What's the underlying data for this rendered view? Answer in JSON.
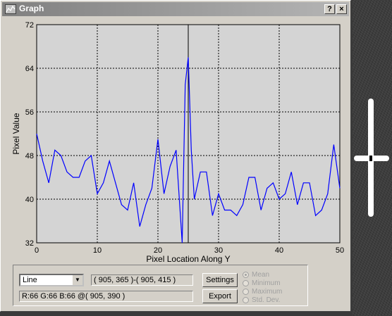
{
  "window": {
    "title": "Graph",
    "help_label": "?",
    "close_label": "×"
  },
  "chart_data": {
    "type": "line",
    "xlabel": "Pixel Location Along Y",
    "ylabel": "Pixel Value",
    "xlim": [
      0,
      50
    ],
    "ylim": [
      32,
      72
    ],
    "xticks": [
      0,
      10,
      20,
      30,
      40,
      50
    ],
    "yticks": [
      32,
      40,
      48,
      56,
      64,
      72
    ],
    "grid": true,
    "marker_x": 25,
    "series": [
      {
        "color": "#0000ff",
        "x": [
          0,
          1,
          2,
          3,
          4,
          5,
          6,
          7,
          8,
          9,
          10,
          11,
          12,
          13,
          14,
          15,
          16,
          17,
          18,
          19,
          20,
          21,
          22,
          23,
          24,
          24.5,
          25,
          25.5,
          26,
          27,
          28,
          29,
          30,
          31,
          32,
          33,
          34,
          35,
          36,
          37,
          38,
          39,
          40,
          41,
          42,
          43,
          44,
          45,
          46,
          47,
          48,
          49,
          50
        ],
        "values": [
          52,
          47,
          43,
          49,
          48,
          45,
          44,
          44,
          47,
          48,
          41,
          43,
          47,
          43,
          39,
          38,
          43,
          35,
          39,
          42,
          51,
          41,
          46,
          49,
          32,
          61,
          66,
          49,
          40,
          45,
          45,
          37,
          41,
          38,
          38,
          37,
          39,
          44,
          44,
          38,
          42,
          43,
          40,
          41,
          45,
          39,
          43,
          43,
          37,
          38,
          41,
          50,
          42
        ]
      }
    ]
  },
  "controls": {
    "plot_mode": "Line",
    "coordinates": "( 905, 365 )-( 905, 415 )",
    "pixel_info": "R:66 G:66 B:66 @( 905, 390 )",
    "settings_label": "Settings",
    "export_label": "Export",
    "stats": [
      "Mean",
      "Minimum",
      "Maximum",
      "Std. Dev."
    ],
    "selected_stat": "Mean"
  },
  "colors": {
    "plot_background": "#d4d4d4",
    "line": "#0000ff",
    "marker": "#000000",
    "titlebar": "#808080"
  }
}
